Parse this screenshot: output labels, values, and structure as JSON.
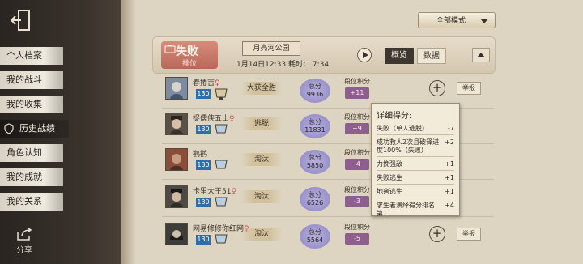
{
  "sidebar": {
    "items": [
      {
        "label": "个人档案"
      },
      {
        "label": "我的战斗"
      },
      {
        "label": "我的收集"
      },
      {
        "label": "历史战绩"
      },
      {
        "label": "角色认知"
      },
      {
        "label": "我的成就"
      },
      {
        "label": "我的关系"
      }
    ],
    "share_label": "分享"
  },
  "filter": {
    "mode_label": "全部模式"
  },
  "match": {
    "result": "失败",
    "role": "排位",
    "map": "月亮河公园",
    "date_time": "1月14日12:33",
    "duration_label": "耗时：",
    "duration": "7:34",
    "tab_overview": "概览",
    "tab_data": "数据"
  },
  "players": [
    {
      "name": "春捲吉",
      "gender": "♀",
      "level": "130",
      "result": "大获全胜",
      "score_label": "总分",
      "score": "9936",
      "rank_label": "段位积分",
      "rank_delta": "+11"
    },
    {
      "name": "捉儒侠五山",
      "gender": "♀",
      "level": "130",
      "result": "逃脱",
      "score_label": "总分",
      "score": "11831",
      "rank_label": "段位积分",
      "rank_delta": "+9"
    },
    {
      "name": "鹳鹳",
      "gender": "",
      "level": "130",
      "result": "淘汰",
      "score_label": "总分",
      "score": "5850",
      "rank_label": "段位积分",
      "rank_delta": "-4"
    },
    {
      "name": "卡里大王51",
      "gender": "♀",
      "level": "130",
      "result": "淘汰",
      "score_label": "总分",
      "score": "6526",
      "rank_label": "段位积分",
      "rank_delta": "-3"
    },
    {
      "name": "网易修修你红网",
      "gender": "♀",
      "level": "130",
      "result": "淘汰",
      "score_label": "总分",
      "score": "5564",
      "rank_label": "段位积分",
      "rank_delta": "-5"
    }
  ],
  "report_label": "举报",
  "detail": {
    "title": "详细得分:",
    "rows": [
      {
        "label": "失败（单人逃脱）",
        "value": "-7"
      },
      {
        "label": "成功救人2次且破译进度100%（失败）",
        "value": "+2"
      },
      {
        "label": "力挽强敌",
        "value": "+1"
      },
      {
        "label": "失败逃生",
        "value": "+1"
      },
      {
        "label": "地窖逃生",
        "value": "+1"
      },
      {
        "label": "求生者演绎得分排名第1",
        "value": "+4"
      }
    ]
  }
}
